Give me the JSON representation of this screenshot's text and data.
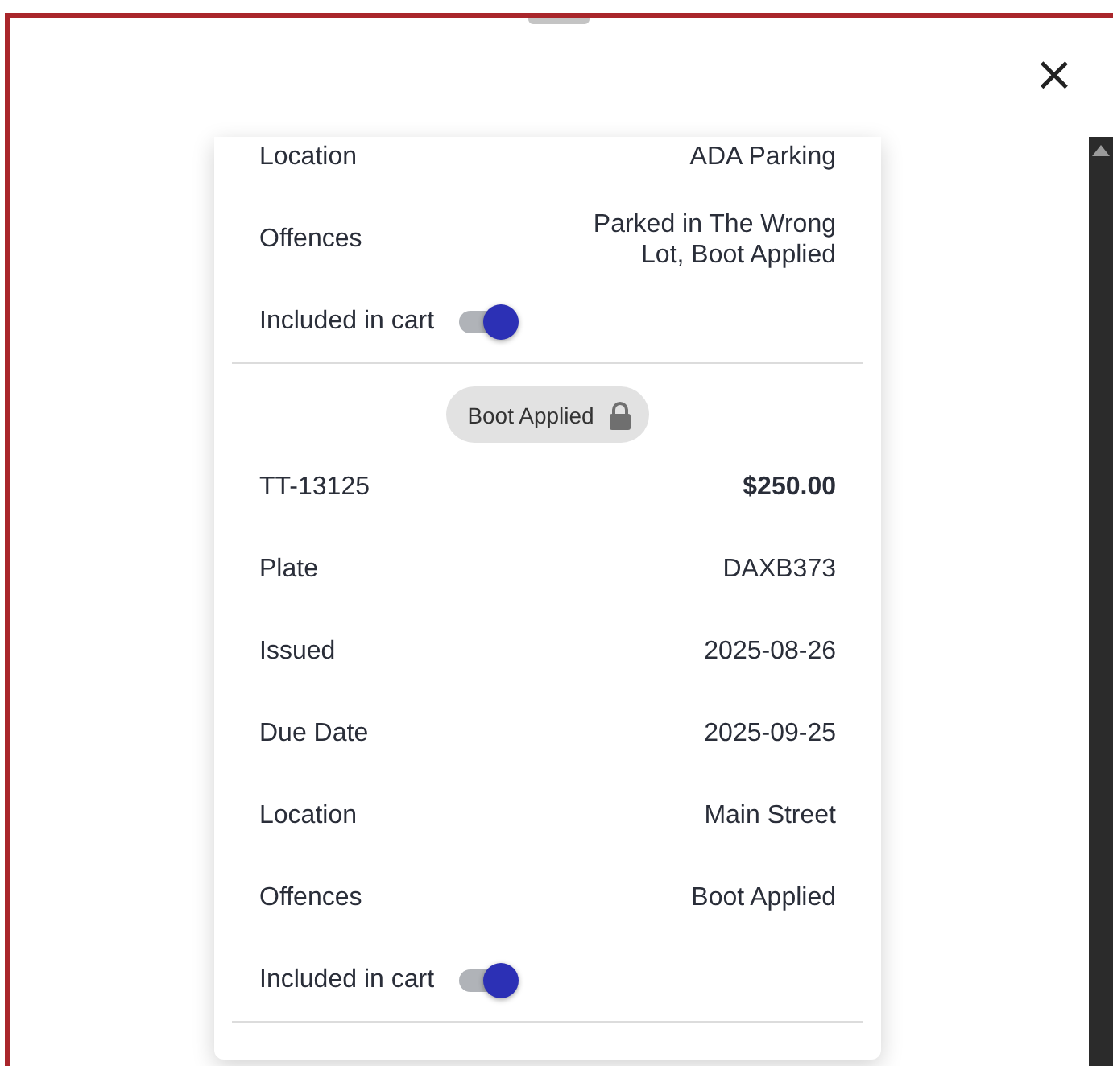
{
  "close_label": "×",
  "tickets": [
    {
      "fields": [
        {
          "label": "Location",
          "value": "ADA Parking"
        },
        {
          "label": "Offences",
          "value": "Parked in The Wrong Lot, Boot Applied"
        }
      ],
      "included_label": "Included in cart",
      "included_in_cart": true
    },
    {
      "status_chip": "Boot Applied",
      "id": "TT-13125",
      "amount": "$250.00",
      "fields": [
        {
          "label": "Plate",
          "value": "DAXB373"
        },
        {
          "label": "Issued",
          "value": "2025-08-26"
        },
        {
          "label": "Due Date",
          "value": "2025-09-25"
        },
        {
          "label": "Location",
          "value": "Main Street"
        },
        {
          "label": "Offences",
          "value": "Boot Applied"
        }
      ],
      "included_label": "Included in cart",
      "included_in_cart": true
    }
  ]
}
